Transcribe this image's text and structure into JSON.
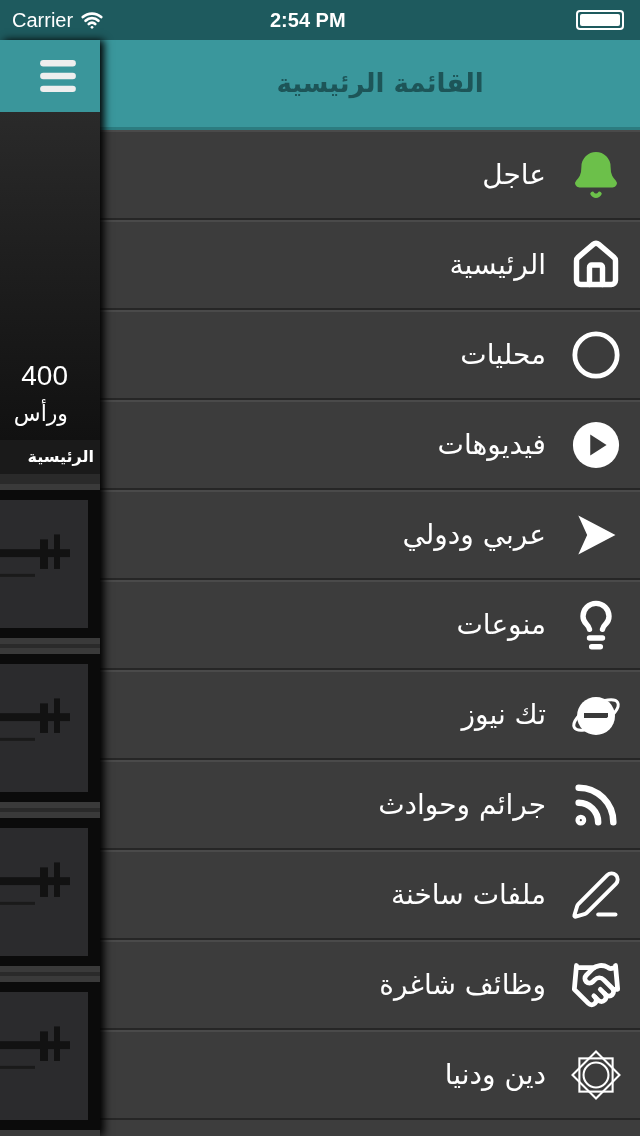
{
  "status_bar": {
    "carrier": "Carrier",
    "time": "2:54 PM"
  },
  "main_view": {
    "headline_line_1": "400",
    "headline_line_2": "ورأس",
    "section_bar": "الرئيسية"
  },
  "menu": {
    "title": "القائمة الرئيسية",
    "items": [
      {
        "label": "عاجل",
        "kind": "bell"
      },
      {
        "label": "الرئيسية",
        "kind": "home"
      },
      {
        "label": "محليات",
        "kind": "circle"
      },
      {
        "label": "فيديوهات",
        "kind": "video"
      },
      {
        "label": "عربي ودولي",
        "kind": "arrow"
      },
      {
        "label": "منوعات",
        "kind": "bulb"
      },
      {
        "label": "تك نيوز",
        "kind": "browser"
      },
      {
        "label": "جرائم وحوادث",
        "kind": "rss"
      },
      {
        "label": "ملفات ساخنة",
        "kind": "pen"
      },
      {
        "label": "وظائف شاغرة",
        "kind": "handshake"
      },
      {
        "label": "دين ودنيا",
        "kind": "star"
      }
    ]
  }
}
